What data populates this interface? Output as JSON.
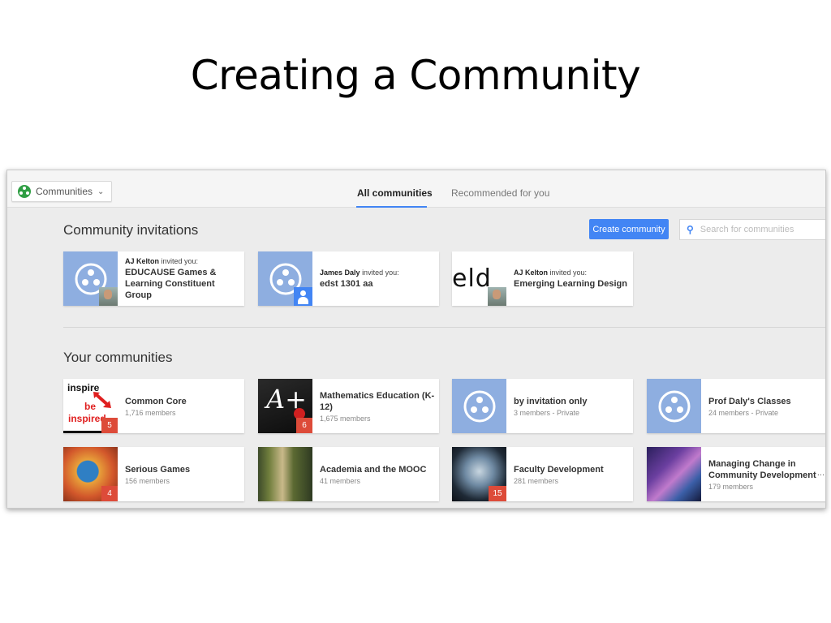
{
  "slide": {
    "title": "Creating a Community"
  },
  "topbar": {
    "communities_label": "Communities",
    "tabs": [
      {
        "label": "All communities",
        "active": true
      },
      {
        "label": "Recommended for you",
        "active": false
      }
    ]
  },
  "invitations": {
    "title": "Community invitations",
    "create_label": "Create community",
    "search_placeholder": "Search for communities",
    "cards": [
      {
        "inviter": "AJ Kelton",
        "invite_suffix": "invited you:",
        "name": "EDUCAUSE Games & Learning Constituent Group"
      },
      {
        "inviter": "James Daly",
        "invite_suffix": "invited you:",
        "name": "edst 1301 aa"
      },
      {
        "inviter": "AJ Kelton",
        "invite_suffix": "invited you:",
        "name": "Emerging Learning Design",
        "logo_text": "eld"
      }
    ]
  },
  "your_communities": {
    "title": "Your communities",
    "cards": [
      {
        "name": "Common Core",
        "meta": "1,716 members",
        "badge": "5",
        "thumb_words": [
          "inspire",
          "be",
          "inspired"
        ]
      },
      {
        "name": "Mathematics Education (K-12)",
        "meta": "1,675 members",
        "badge": "6",
        "thumb_text": "A+"
      },
      {
        "name": "by invitation only",
        "meta": "3 members - Private"
      },
      {
        "name": "Prof Daly's Classes",
        "meta": "24 members - Private"
      },
      {
        "name": "Serious Games",
        "meta": "156 members",
        "badge": "4"
      },
      {
        "name": "Academia and the MOOC",
        "meta": "41 members"
      },
      {
        "name": "Faculty Development",
        "meta": "281 members",
        "badge": "15"
      },
      {
        "name": "Managing Change in Community Development",
        "meta": "179 members",
        "more": "..."
      }
    ]
  },
  "colors": {
    "accent": "#4285f4",
    "badge": "#dd4b39",
    "placeholder_thumb": "#8eaee0"
  }
}
